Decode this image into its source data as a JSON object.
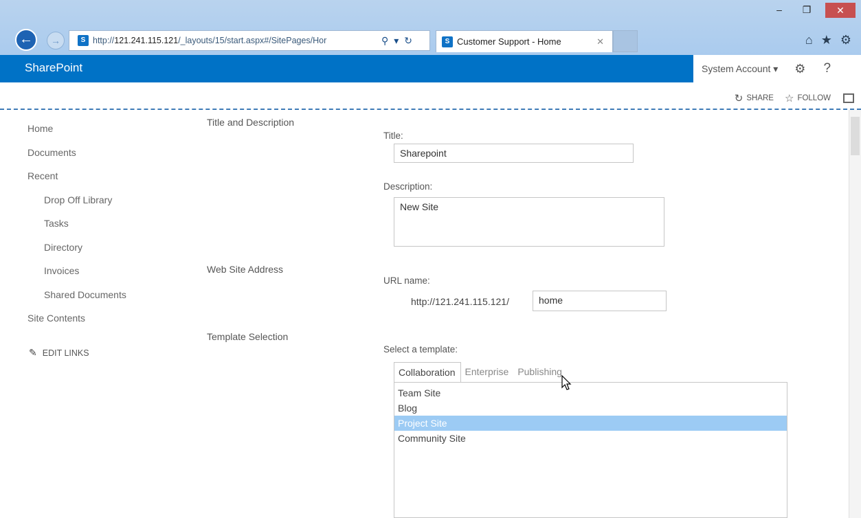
{
  "browser": {
    "window_controls": {
      "minimize": "–",
      "restore": "❐",
      "close": "✕"
    },
    "address": {
      "prefix": "http://",
      "host": "121.241.115.121",
      "path": "/_layouts/15/start.aspx#/SitePages/Hor",
      "tools": {
        "search": "⚲",
        "dropdown": "▾",
        "refresh": "↻"
      }
    },
    "tab_title": "Customer Support - Home",
    "tab_close": "✕",
    "icons": [
      "home-icon",
      "favorites-icon",
      "tools-icon"
    ]
  },
  "suitebar": {
    "brand": "SharePoint",
    "user": "System Account ▾",
    "help": "?"
  },
  "actions": {
    "share": "SHARE",
    "follow": "FOLLOW"
  },
  "nav": {
    "items": [
      {
        "label": "Home",
        "sub": false
      },
      {
        "label": "Documents",
        "sub": false
      },
      {
        "label": "Recent",
        "sub": false
      },
      {
        "label": "Drop Off Library",
        "sub": true
      },
      {
        "label": "Tasks",
        "sub": true
      },
      {
        "label": "Directory",
        "sub": true
      },
      {
        "label": "Invoices",
        "sub": true
      },
      {
        "label": "Shared Documents",
        "sub": true
      },
      {
        "label": "Site Contents",
        "sub": false
      }
    ],
    "edit_links": "EDIT LINKS"
  },
  "sections": {
    "title_desc": "Title and Description",
    "web_address": "Web Site Address",
    "template": "Template Selection"
  },
  "form": {
    "title_label": "Title:",
    "title_value": "Sharepoint",
    "description_label": "Description:",
    "description_value": "New Site",
    "url_label": "URL name:",
    "url_prefix": "http://121.241.115.121/",
    "url_value": "home",
    "template_label": "Select a template:",
    "template_tabs": [
      "Collaboration",
      "Enterprise",
      "Publishing"
    ],
    "active_tab": "Collaboration",
    "templates": [
      "Team Site",
      "Blog",
      "Project Site",
      "Community Site"
    ],
    "selected_template": "Project Site"
  }
}
